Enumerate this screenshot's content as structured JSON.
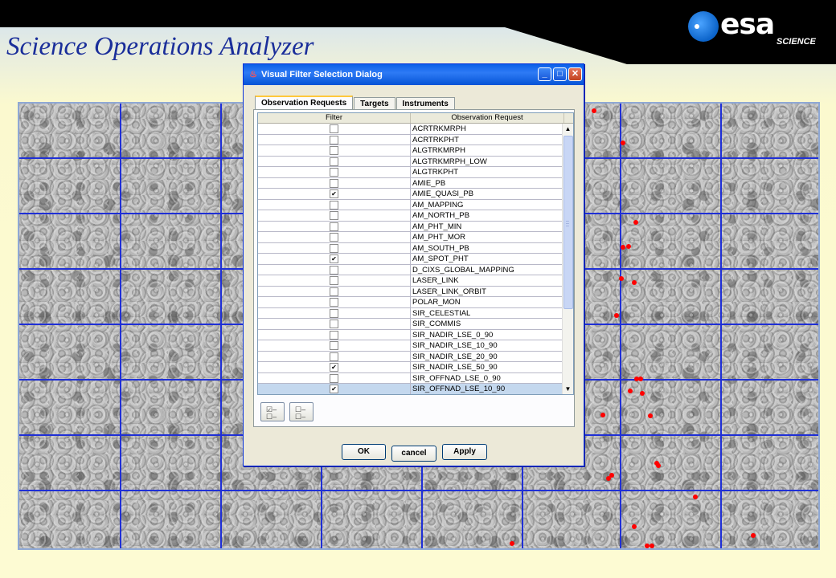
{
  "header": {
    "title": "Science Operations Analyzer",
    "logo_text": "esa",
    "logo_subtext": "SCIENCE"
  },
  "dialog": {
    "title": "Visual Filter Selection Dialog",
    "tabs": [
      {
        "label": "Observation Requests",
        "active": true
      },
      {
        "label": "Targets",
        "active": false
      },
      {
        "label": "Instruments",
        "active": false
      }
    ],
    "columns": [
      "Filter",
      "Observation Request"
    ],
    "rows": [
      {
        "name": "ACRTRKMRPH",
        "checked": false,
        "mark": ""
      },
      {
        "name": "ACRTRKPHT",
        "checked": false,
        "mark": ""
      },
      {
        "name": "ALGTRKMRPH",
        "checked": false,
        "mark": ""
      },
      {
        "name": "ALGTRKMRPH_LOW",
        "checked": false,
        "mark": ""
      },
      {
        "name": "ALGTRKPHT",
        "checked": false,
        "mark": ""
      },
      {
        "name": "AMIE_PB",
        "checked": false,
        "mark": ""
      },
      {
        "name": "AMIE_QUASI_PB",
        "checked": true,
        "mark": "✔"
      },
      {
        "name": "AM_MAPPING",
        "checked": false,
        "mark": ""
      },
      {
        "name": "AM_NORTH_PB",
        "checked": false,
        "mark": ""
      },
      {
        "name": "AM_PHT_MIN",
        "checked": false,
        "mark": ""
      },
      {
        "name": "AM_PHT_MOR",
        "checked": false,
        "mark": ""
      },
      {
        "name": "AM_SOUTH_PB",
        "checked": false,
        "mark": ""
      },
      {
        "name": "AM_SPOT_PHT",
        "checked": true,
        "mark": "✔"
      },
      {
        "name": "D_CIXS_GLOBAL_MAPPING",
        "checked": false,
        "mark": ""
      },
      {
        "name": "LASER_LINK",
        "checked": false,
        "mark": ""
      },
      {
        "name": "LASER_LINK_ORBIT",
        "checked": false,
        "mark": ""
      },
      {
        "name": "POLAR_MON",
        "checked": false,
        "mark": ""
      },
      {
        "name": "SIR_CELESTIAL",
        "checked": false,
        "mark": ""
      },
      {
        "name": "SIR_COMMIS",
        "checked": false,
        "mark": ""
      },
      {
        "name": "SIR_NADIR_LSE_0_90",
        "checked": false,
        "mark": ""
      },
      {
        "name": "SIR_NADIR_LSE_10_90",
        "checked": false,
        "mark": ""
      },
      {
        "name": "SIR_NADIR_LSE_20_90",
        "checked": false,
        "mark": ""
      },
      {
        "name": "SIR_NADIR_LSE_50_90",
        "checked": true,
        "mark": "✔"
      },
      {
        "name": "SIR_OFFNAD_LSE_0_90",
        "checked": false,
        "mark": ""
      },
      {
        "name": "SIR_OFFNAD_LSE_10_90",
        "checked": true,
        "mark": "✔",
        "selected": true
      }
    ],
    "buttons": {
      "ok": "OK",
      "cancel": "cancel",
      "apply": "Apply"
    },
    "icons": {
      "select_all": "select-all-icon",
      "deselect_all": "deselect-all-icon"
    }
  },
  "colors": {
    "grid": "#1f2fd6",
    "points": "#ff0000",
    "title": "#1a2e9a"
  }
}
